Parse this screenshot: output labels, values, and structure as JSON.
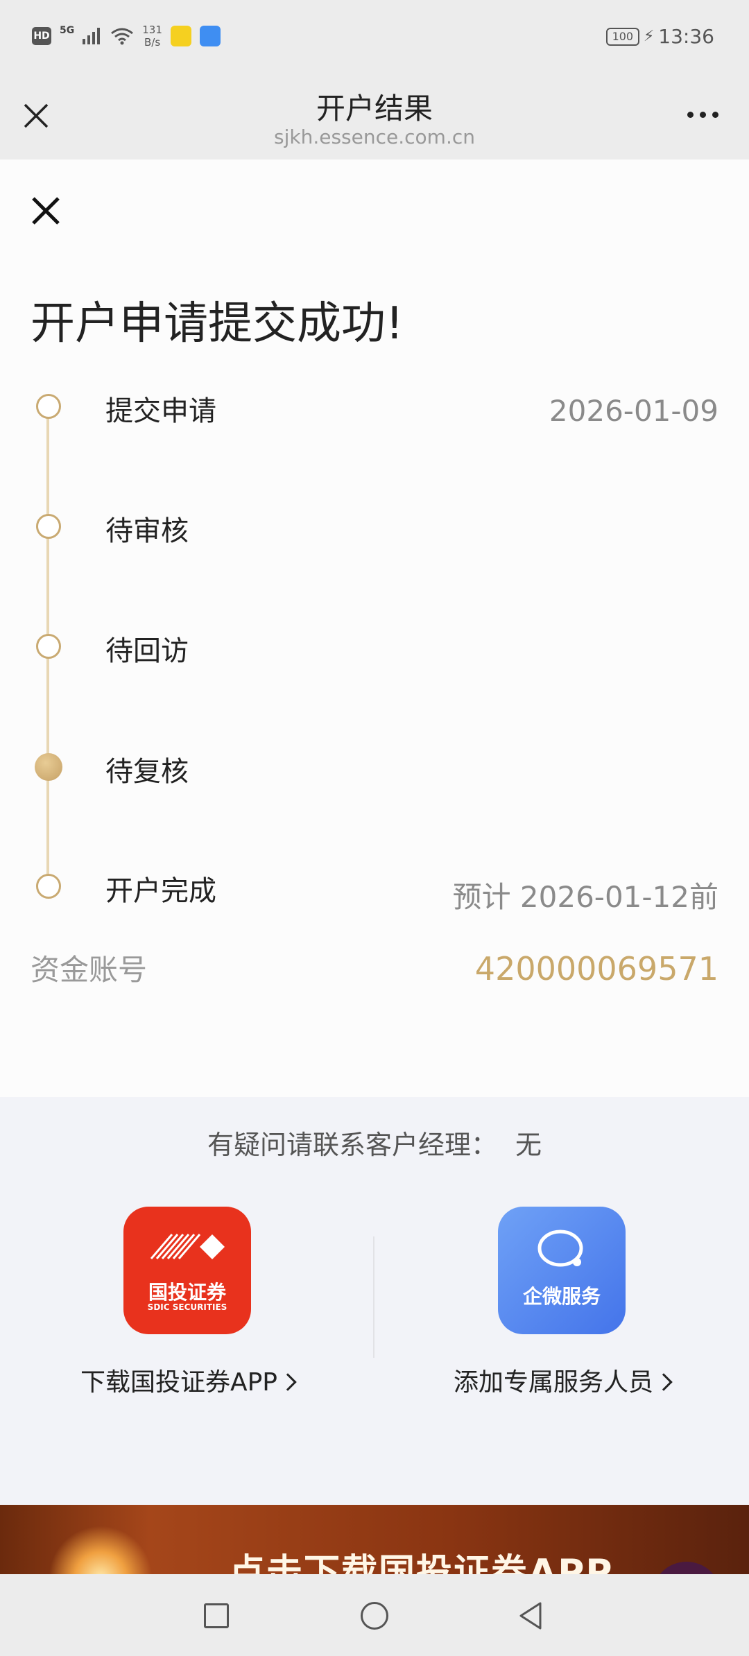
{
  "status_bar": {
    "hd": "HD",
    "network": "5G",
    "speed_value": "131",
    "speed_unit": "B/s",
    "battery": "100",
    "time": "13:36"
  },
  "title_bar": {
    "title": "开户结果",
    "url": "sjkh.essence.com.cn"
  },
  "page": {
    "heading": "开户申请提交成功!",
    "timeline": [
      {
        "label": "提交申请",
        "date": "2026-01-09"
      },
      {
        "label": "待审核",
        "date": ""
      },
      {
        "label": "待回访",
        "date": ""
      },
      {
        "label": "待复核",
        "date": "",
        "active": true
      },
      {
        "label": "开户完成",
        "date": "预计 2026-01-12前"
      }
    ],
    "account": {
      "label": "资金账号",
      "value": "420000069571"
    }
  },
  "contact": {
    "prompt": "有疑问请联系客户经理：",
    "manager": "无"
  },
  "promos": {
    "sdic": {
      "icon_text": "国投证券",
      "icon_sub": "SDIC SECURITIES",
      "label": "下载国投证券APP"
    },
    "wework": {
      "icon_text": "企微服务",
      "label": "添加专属服务人员"
    }
  },
  "banner": {
    "text": "点击下载国投证券APP"
  },
  "colors": {
    "gold": "#c9a86a",
    "sdic_red": "#e8321d",
    "wework_blue": "#5b8ef0"
  }
}
